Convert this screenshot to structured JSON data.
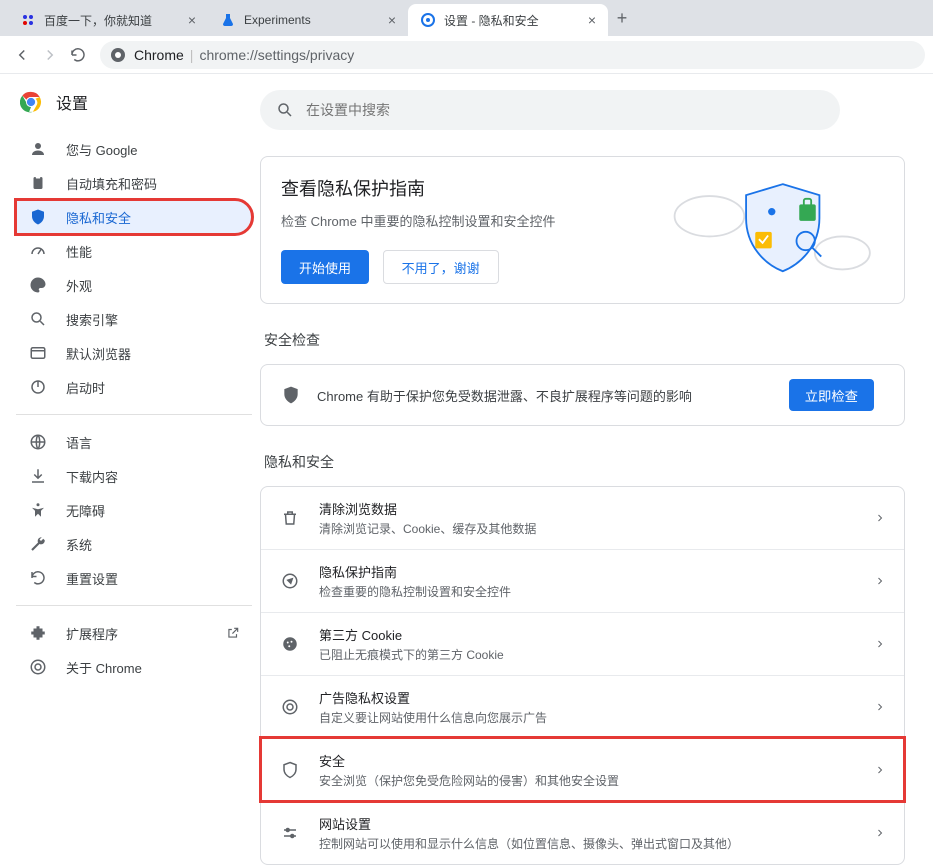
{
  "tabs": [
    {
      "title": "百度一下，你就知道"
    },
    {
      "title": "Experiments"
    },
    {
      "title": "设置 - 隐私和安全"
    }
  ],
  "address": {
    "host": "Chrome",
    "path": "chrome://settings/privacy"
  },
  "header": {
    "title": "设置"
  },
  "search": {
    "placeholder": "在设置中搜索"
  },
  "sidebar": {
    "items": [
      {
        "label": "您与 Google"
      },
      {
        "label": "自动填充和密码"
      },
      {
        "label": "隐私和安全"
      },
      {
        "label": "性能"
      },
      {
        "label": "外观"
      },
      {
        "label": "搜索引擎"
      },
      {
        "label": "默认浏览器"
      },
      {
        "label": "启动时"
      }
    ],
    "items2": [
      {
        "label": "语言"
      },
      {
        "label": "下载内容"
      },
      {
        "label": "无障碍"
      },
      {
        "label": "系统"
      },
      {
        "label": "重置设置"
      }
    ],
    "items3": [
      {
        "label": "扩展程序"
      },
      {
        "label": "关于 Chrome"
      }
    ]
  },
  "guide": {
    "title": "查看隐私保护指南",
    "subtitle": "检查 Chrome 中重要的隐私控制设置和安全控件",
    "primary": "开始使用",
    "secondary": "不用了，谢谢"
  },
  "safety": {
    "section": "安全检查",
    "text": "Chrome 有助于保护您免受数据泄露、不良扩展程序等问题的影响",
    "button": "立即检查"
  },
  "privacy": {
    "section": "隐私和安全",
    "rows": [
      {
        "title": "清除浏览数据",
        "sub": "清除浏览记录、Cookie、缓存及其他数据"
      },
      {
        "title": "隐私保护指南",
        "sub": "检查重要的隐私控制设置和安全控件"
      },
      {
        "title": "第三方 Cookie",
        "sub": "已阻止无痕模式下的第三方 Cookie"
      },
      {
        "title": "广告隐私权设置",
        "sub": "自定义要让网站使用什么信息向您展示广告"
      },
      {
        "title": "安全",
        "sub": "安全浏览（保护您免受危险网站的侵害）和其他安全设置"
      },
      {
        "title": "网站设置",
        "sub": "控制网站可以使用和显示什么信息（如位置信息、摄像头、弹出式窗口及其他）"
      }
    ]
  }
}
